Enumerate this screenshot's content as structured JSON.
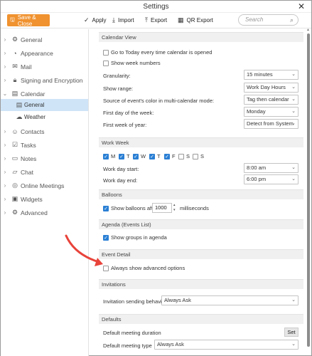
{
  "window": {
    "title": "Settings",
    "close_label": "✕"
  },
  "toolbar": {
    "save_close": "Save & Close",
    "apply": "Apply",
    "import": "Import",
    "export": "Export",
    "qr_export": "QR Export",
    "search_placeholder": "Search"
  },
  "sidebar": {
    "items": [
      {
        "label": "General",
        "icon": "gear-icon"
      },
      {
        "label": "Appearance",
        "icon": "palette-icon"
      },
      {
        "label": "Mail",
        "icon": "mail-icon"
      },
      {
        "label": "Signing and Encryption",
        "icon": "lock-icon"
      },
      {
        "label": "Calendar",
        "icon": "calendar-icon"
      },
      {
        "label": "Contacts",
        "icon": "contacts-icon"
      },
      {
        "label": "Tasks",
        "icon": "tasks-icon"
      },
      {
        "label": "Notes",
        "icon": "notes-icon"
      },
      {
        "label": "Chat",
        "icon": "chat-icon"
      },
      {
        "label": "Online Meetings",
        "icon": "meetings-icon"
      },
      {
        "label": "Widgets",
        "icon": "widgets-icon"
      },
      {
        "label": "Advanced",
        "icon": "advanced-icon"
      }
    ],
    "calendar_sub": [
      {
        "label": "General",
        "active": true
      },
      {
        "label": "Weather",
        "active": false
      }
    ]
  },
  "calendar_view": {
    "header": "Calendar View",
    "go_today": "Go to Today every time calendar is opened",
    "week_numbers": "Show week numbers",
    "granularity": {
      "label": "Granularity:",
      "value": "15 minutes"
    },
    "show_range": {
      "label": "Show range:",
      "value": "Work Day Hours"
    },
    "source_color": {
      "label": "Source of event's color in multi-calendar mode:",
      "value": "Tag then calendar"
    },
    "first_day": {
      "label": "First day of the week:",
      "value": "Monday"
    },
    "first_week": {
      "label": "First week of year:",
      "value": "Detect from System"
    }
  },
  "work_week": {
    "header": "Work Week",
    "days": [
      {
        "label": "M",
        "checked": true
      },
      {
        "label": "T",
        "checked": true
      },
      {
        "label": "W",
        "checked": true
      },
      {
        "label": "T",
        "checked": true
      },
      {
        "label": "F",
        "checked": true
      },
      {
        "label": "S",
        "checked": false
      },
      {
        "label": "S",
        "checked": false
      }
    ],
    "start": {
      "label": "Work day start:",
      "value": "8:00 am"
    },
    "end": {
      "label": "Work day end:",
      "value": "6:00 pm"
    }
  },
  "balloons": {
    "header": "Balloons",
    "label_before": "Show balloons after",
    "value": "1000",
    "label_after": "milliseconds"
  },
  "agenda": {
    "header": "Agenda (Events List)",
    "show_groups": "Show groups in agenda"
  },
  "event_detail": {
    "header": "Event Detail",
    "always_advanced": "Always show advanced options"
  },
  "invitations": {
    "header": "Invitations",
    "label": "Invitation sending behavior:",
    "value": "Always Ask"
  },
  "defaults": {
    "header": "Defaults",
    "duration_label": "Default meeting duration",
    "set_button": "Set",
    "type_label": "Default meeting type",
    "type_value": "Always Ask"
  },
  "colors": {
    "accent": "#f0922f",
    "selection": "#cfe4f7",
    "checkbox": "#2a7fd4",
    "annotation_arrow": "#e8433a"
  }
}
